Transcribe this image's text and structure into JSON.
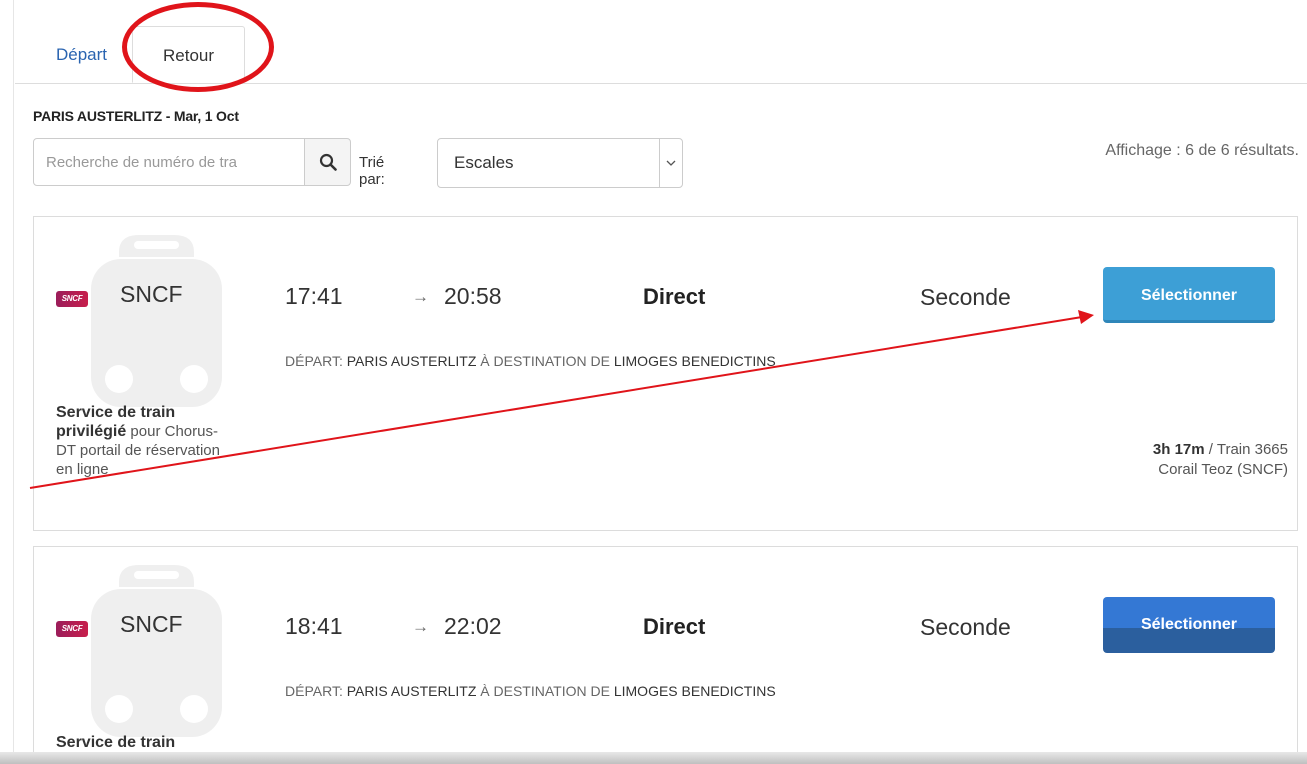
{
  "tabs": [
    {
      "label": "Départ",
      "active": false
    },
    {
      "label": "Retour",
      "active": true
    }
  ],
  "route_title": "PARIS AUSTERLITZ - Mar, 1 Oct",
  "search": {
    "placeholder": "Recherche de numéro de tra"
  },
  "sort": {
    "label": "Trié par:",
    "selected": "Escales"
  },
  "results_count": "Affichage : 6 de 6 résultats.",
  "colors": {
    "accent": "#3d9fd6",
    "annotation": "#e0141a",
    "link": "#2a64b0"
  },
  "icons": {
    "search": "magnifier-icon",
    "sort_caret": "chevron-down-icon",
    "train": "train-icon"
  },
  "results": [
    {
      "carrier_logo": "SNCF",
      "carrier": "SNCF",
      "departure_time": "17:41",
      "arrow": "→",
      "arrival_time": "20:58",
      "stops": "Direct",
      "fare_class": "Seconde",
      "select_label": "Sélectionner",
      "departure_label": "DÉPART: ",
      "departure_station": "PARIS AUSTERLITZ",
      "destination_label": " À DESTINATION DE ",
      "destination_station": "LIMOGES BENEDICTINS",
      "service_bold": "Service de train privilégié",
      "service_rest": " pour Chorus-DT portail de réservation en ligne",
      "duration": "3h 17m",
      "train_info": " / Train 3665",
      "train_type": "Corail Teoz (SNCF)"
    },
    {
      "carrier_logo": "SNCF",
      "carrier": "SNCF",
      "departure_time": "18:41",
      "arrow": "→",
      "arrival_time": "22:02",
      "stops": "Direct",
      "fare_class": "Seconde",
      "select_label": "Sélectionner",
      "departure_label": "DÉPART: ",
      "departure_station": "PARIS AUSTERLITZ",
      "destination_label": " À DESTINATION DE ",
      "destination_station": "LIMOGES BENEDICTINS",
      "service_bold": "Service de train",
      "service_rest": ""
    }
  ]
}
